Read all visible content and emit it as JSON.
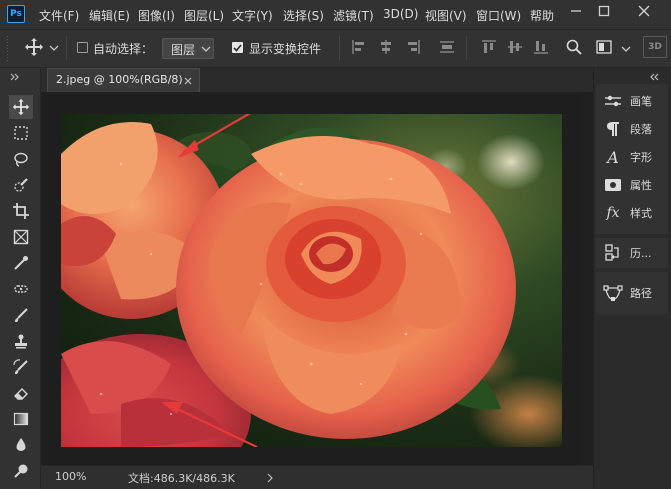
{
  "app": {
    "logo_text": "Ps"
  },
  "menu": {
    "items": [
      "文件(F)",
      "编辑(E)",
      "图像(I)",
      "图层(L)",
      "文字(Y)",
      "选择(S)",
      "滤镜(T)",
      "3D(D)",
      "视图(V)",
      "窗口(W)",
      "帮助"
    ]
  },
  "options": {
    "auto_select_label": "自动选择：",
    "auto_select_checked": false,
    "layer_dropdown_value": "图层",
    "show_transform_label": "显示变换控件",
    "show_transform_checked": true,
    "panel_3d_label": "3D"
  },
  "document": {
    "tab_title": "2.jpeg @ 100%(RGB/8)",
    "zoom": "100%",
    "doc_info": "文档:486.3K/486.3K"
  },
  "panels": {
    "items": [
      {
        "label": "画笔",
        "icon": "brush-settings-icon"
      },
      {
        "label": "段落",
        "icon": "paragraph-icon"
      },
      {
        "label": "字形",
        "icon": "glyphs-icon"
      },
      {
        "label": "属性",
        "icon": "properties-icon"
      },
      {
        "label": "样式",
        "icon": "styles-icon"
      },
      {
        "label": "历...",
        "icon": "history-icon"
      },
      {
        "label": "路径",
        "icon": "paths-icon"
      }
    ]
  },
  "colors": {
    "accent": "#31a8ff",
    "arrow_annotation": "#e8393a"
  }
}
